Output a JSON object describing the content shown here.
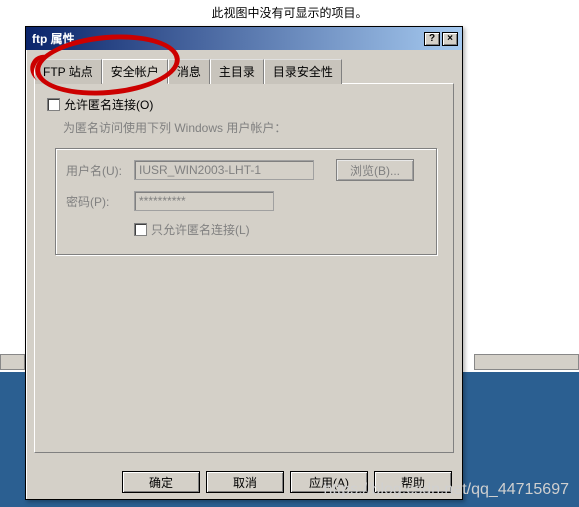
{
  "messages": {
    "top": "此视图中没有可显示的项目。"
  },
  "dialog": {
    "title": "ftp 属性",
    "help": "?",
    "close": "×"
  },
  "tabs": [
    {
      "label": "FTP 站点"
    },
    {
      "label": "安全帐户"
    },
    {
      "label": "消息"
    },
    {
      "label": "主目录"
    },
    {
      "label": "目录安全性"
    }
  ],
  "form": {
    "allow_anon": "允许匿名连接(O)",
    "desc": "为匿名访问使用下列 Windows 用户帐户：",
    "username_label": "用户名(U):",
    "username_value": "IUSR_WIN2003-LHT-1",
    "browse_label": "浏览(B)...",
    "password_label": "密码(P):",
    "password_value": "**********",
    "only_anon": "只允许匿名连接(L)"
  },
  "buttons": {
    "ok": "确定",
    "cancel": "取消",
    "apply": "应用(A)",
    "help": "帮助"
  },
  "watermark": "https://blog.csdn.net/qq_44715697"
}
